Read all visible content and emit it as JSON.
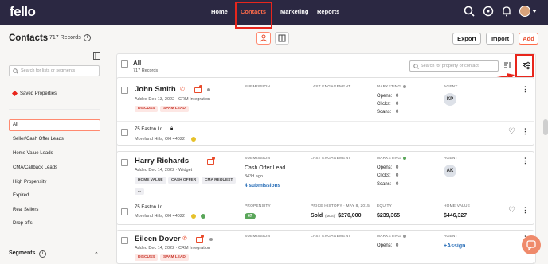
{
  "topbar": {
    "logo": "fello",
    "nav": [
      "Home",
      "Contacts",
      "Marketing",
      "Reports"
    ],
    "active": "Contacts"
  },
  "header": {
    "title": "Contacts",
    "records": "717 Records",
    "buttons": {
      "export": "Export",
      "import": "Import",
      "add": "Add"
    }
  },
  "sidebar": {
    "search_placeholder": "Search for lists or segments",
    "saved": "Saved Properties",
    "items": [
      "All",
      "Seller/Cash Offer Leads",
      "Home Value Leads",
      "CMA/Callback Leads",
      "High Propensity",
      "Expired",
      "Real Sellers",
      "Drop-offs"
    ],
    "segments": "Segments"
  },
  "list": {
    "all": "All",
    "all_count": "717 Records",
    "search_placeholder": "Search for property or contact"
  },
  "contacts": [
    {
      "name": "John Smith",
      "added": "Added Dec 13, 2022 · CRM Integration",
      "tags": [
        "DISCUSS",
        "SPAM LEAD"
      ],
      "submission_hdr": "SUBMISSION",
      "engagement_hdr": "LAST ENGAGEMENT",
      "marketing_hdr": "MARKETING",
      "agent_hdr": "AGENT",
      "opens": "Opens:",
      "opens_v": "0",
      "clicks": "Clicks:",
      "clicks_v": "0",
      "scans": "Scans:",
      "scans_v": "0",
      "agent": "KP",
      "address": "75 Easton Ln",
      "city": "Moreland Hills, OH 44022"
    },
    {
      "name": "Harry Richards",
      "added": "Added Dec 14, 2022 · Widget",
      "tags": [
        "HOME VALUE",
        "CASH OFFER",
        "CMA REQUEST",
        "..."
      ],
      "submission_hdr": "SUBMISSION",
      "submission": "Cash Offer Lead",
      "submission_ago": "343d ago",
      "submissions_link": "4 submissions",
      "engagement_hdr": "LAST ENGAGEMENT",
      "marketing_hdr": "MARKETING",
      "agent_hdr": "AGENT",
      "opens": "Opens:",
      "opens_v": "0",
      "clicks": "Clicks:",
      "clicks_v": "0",
      "scans": "Scans:",
      "scans_v": "0",
      "agent": "AK",
      "address": "75 Easton Ln",
      "city": "Moreland Hills, OH 44022",
      "propensity_hdr": "PROPENSITY",
      "propensity": "67",
      "price_hdr": "PRICE HISTORY · MAY 8, 2015",
      "price": "Sold",
      "price_src": "(MLS)",
      "price_v": "· $270,000",
      "equity_hdr": "EQUITY",
      "equity": "$239,365",
      "homevalue_hdr": "HOME VALUE",
      "homevalue": "$446,327"
    },
    {
      "name": "Eileen Dover",
      "added": "Added Dec 14, 2022 · CRM Integration",
      "tags": [
        "DISCUSS",
        "SPAM LEAD"
      ],
      "submission_hdr": "SUBMISSION",
      "engagement_hdr": "LAST ENGAGEMENT",
      "marketing_hdr": "MARKETING",
      "agent_hdr": "AGENT",
      "opens": "Opens:",
      "opens_v": "0",
      "assign": "+Assign"
    }
  ]
}
